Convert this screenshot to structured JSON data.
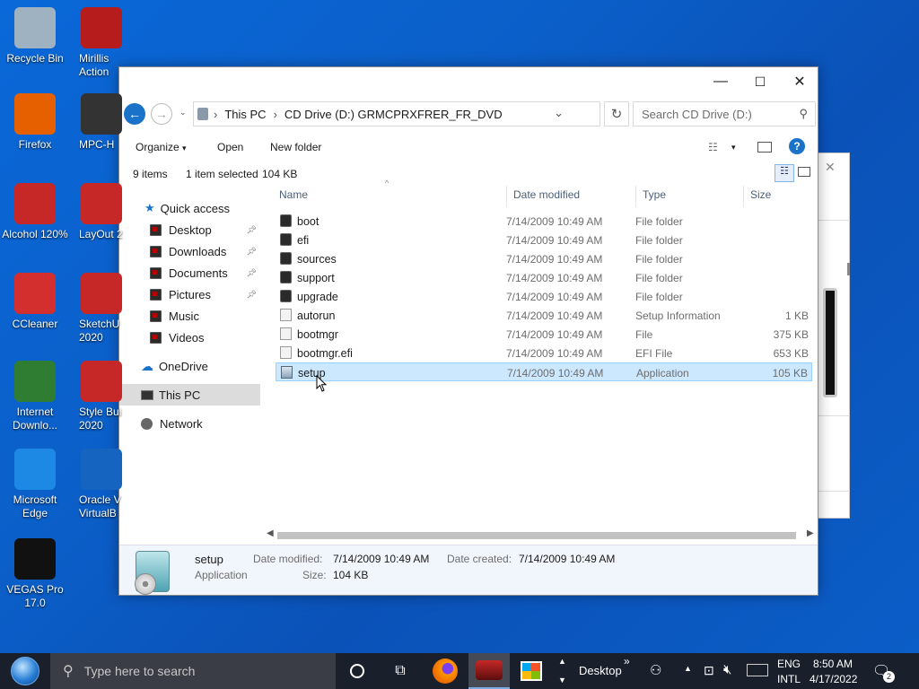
{
  "desktop": {
    "icons_col1": [
      {
        "label": "Recycle Bin",
        "icon": "recycle-bin-icon",
        "color": "#9fb2c2"
      },
      {
        "label": "Firefox",
        "icon": "firefox-icon",
        "color": "#e66000"
      },
      {
        "label": "Alcohol 120%",
        "icon": "alcohol-120-icon",
        "color": "#c62828"
      },
      {
        "label": "CCleaner",
        "icon": "ccleaner-icon",
        "color": "#d32f2f"
      },
      {
        "label": "Internet Downlo...",
        "icon": "internet-download-manager-icon",
        "color": "#2e7d32"
      },
      {
        "label": "Microsoft Edge",
        "icon": "microsoft-edge-icon",
        "color": "#1e88e5"
      },
      {
        "label": "VEGAS Pro 17.0",
        "icon": "vegas-pro-icon",
        "color": "#111111"
      }
    ],
    "icons_col2": [
      {
        "label": "Mirillis Action",
        "icon": "mirillis-action-icon",
        "color": "#b71c1c"
      },
      {
        "label": "MPC-H",
        "icon": "mpc-hc-icon",
        "color": "#333333"
      },
      {
        "label": "LayOut 2",
        "icon": "layout-icon",
        "color": "#c62828"
      },
      {
        "label": "SketchU 2020",
        "icon": "sketchup-icon",
        "color": "#c62828"
      },
      {
        "label": "Style Bui 2020",
        "icon": "style-builder-icon",
        "color": "#c62828"
      },
      {
        "label": "Oracle V VirtualB",
        "icon": "virtualbox-icon",
        "color": "#1565c0"
      }
    ]
  },
  "explorer": {
    "window_buttons": {
      "minimize": "—",
      "maximize": "☐",
      "close": "✕"
    },
    "breadcrumb": [
      "This PC",
      "CD Drive (D:) GRMCPRXFRER_FR_DVD"
    ],
    "search_placeholder": "Search CD Drive (D:)",
    "toolbar": {
      "organize": "Organize",
      "open": "Open",
      "new_folder": "New folder"
    },
    "status": {
      "items": "9 items",
      "selected": "1 item selected",
      "size": "104 KB"
    },
    "nav": {
      "quick_access": "Quick access",
      "quick_items": [
        "Desktop",
        "Downloads",
        "Documents",
        "Pictures",
        "Music",
        "Videos"
      ],
      "onedrive": "OneDrive",
      "this_pc": "This PC",
      "network": "Network"
    },
    "columns": {
      "name": "Name",
      "date": "Date modified",
      "type": "Type",
      "size": "Size"
    },
    "files": [
      {
        "name": "boot",
        "date": "7/14/2009 10:49 AM",
        "type": "File folder",
        "size": "",
        "icon": "folder-icon"
      },
      {
        "name": "efi",
        "date": "7/14/2009 10:49 AM",
        "type": "File folder",
        "size": "",
        "icon": "folder-icon"
      },
      {
        "name": "sources",
        "date": "7/14/2009 10:49 AM",
        "type": "File folder",
        "size": "",
        "icon": "folder-icon"
      },
      {
        "name": "support",
        "date": "7/14/2009 10:49 AM",
        "type": "File folder",
        "size": "",
        "icon": "folder-icon"
      },
      {
        "name": "upgrade",
        "date": "7/14/2009 10:49 AM",
        "type": "File folder",
        "size": "",
        "icon": "folder-icon"
      },
      {
        "name": "autorun",
        "date": "7/14/2009 10:49 AM",
        "type": "Setup Information",
        "size": "1 KB",
        "icon": "setup-info-file-icon"
      },
      {
        "name": "bootmgr",
        "date": "7/14/2009 10:49 AM",
        "type": "File",
        "size": "375 KB",
        "icon": "file-icon"
      },
      {
        "name": "bootmgr.efi",
        "date": "7/14/2009 10:49 AM",
        "type": "EFI File",
        "size": "653 KB",
        "icon": "efi-file-icon"
      },
      {
        "name": "setup",
        "date": "7/14/2009 10:49 AM",
        "type": "Application",
        "size": "105 KB",
        "icon": "application-icon",
        "selected": true
      }
    ],
    "details": {
      "name": "setup",
      "type": "Application",
      "date_modified_label": "Date modified:",
      "date_modified": "7/14/2009 10:49 AM",
      "date_created_label": "Date created:",
      "date_created": "7/14/2009 10:49 AM",
      "size_label": "Size:",
      "size": "104 KB"
    }
  },
  "taskbar": {
    "search_placeholder": "Type here to search",
    "desktop_label": "Desktop",
    "chevron": "»",
    "language": "ENG",
    "layout": "INTL",
    "time": "8:50 AM",
    "date": "4/17/2022",
    "notification_count": "2"
  },
  "colors": {
    "selection": "#cce8ff",
    "accent": "#0078d7",
    "taskbar": "#1a1f2c"
  }
}
